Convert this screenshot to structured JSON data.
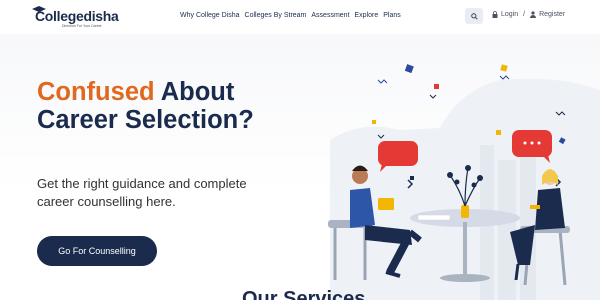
{
  "header": {
    "logo": {
      "brand": "Collegedisha",
      "tagline": "Direction For Your Career"
    },
    "nav": [
      {
        "label": "Why College Disha"
      },
      {
        "label": "Colleges By Stream"
      },
      {
        "label": "Assessment"
      },
      {
        "label": "Explore"
      },
      {
        "label": "Plans"
      }
    ],
    "search_icon": "search-icon",
    "login_label": "Login",
    "separator": "/",
    "register_label": "Register"
  },
  "hero": {
    "title_accent": "Confused",
    "title_rest": " About Career Selection?",
    "subtitle": "Get the right guidance and complete career counselling here.",
    "cta_label": "Go For Counselling"
  },
  "section": {
    "heading": "Our Services"
  },
  "colors": {
    "navy": "#1b2b4d",
    "orange": "#e0691f",
    "red_bubble": "#e53935",
    "yellow": "#f2b705"
  }
}
